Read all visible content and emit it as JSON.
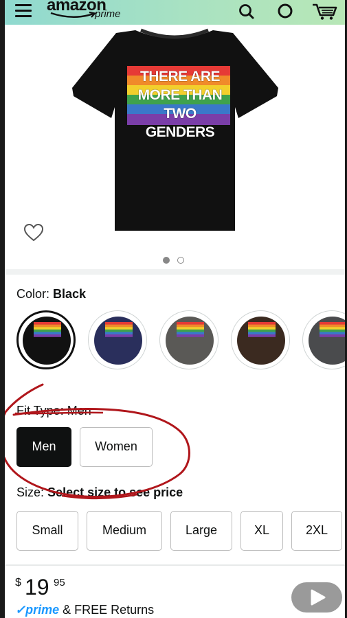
{
  "header": {
    "logo_main": "amazon",
    "logo_sub": "prime",
    "menu_icon": "hamburger-menu-icon",
    "search_icon": "search-icon",
    "voice_icon": "circle-icon",
    "cart_icon": "cart-icon"
  },
  "product": {
    "shirt_text_lines": [
      "THERE ARE",
      "MORE THAN",
      "TWO GENDERS"
    ],
    "shirt_color": "#111111",
    "image_dots": {
      "count": 2,
      "active": 1
    }
  },
  "color_selector": {
    "label": "Color:",
    "value": "Black",
    "swatches": [
      {
        "name": "Black",
        "hex": "#111111",
        "selected": true
      },
      {
        "name": "Navy",
        "hex": "#2a2f5c",
        "selected": false
      },
      {
        "name": "Gray",
        "hex": "#5a5956",
        "selected": false
      },
      {
        "name": "Brown",
        "hex": "#3b2a20",
        "selected": false
      },
      {
        "name": "Dark Heather",
        "hex": "#4a4b4d",
        "selected": false
      }
    ]
  },
  "fit_type": {
    "label": "Fit Type: Men",
    "options": [
      "Men",
      "Women"
    ],
    "selected": "Men"
  },
  "size": {
    "label": "Size:",
    "hint": "Select size to see price",
    "options": [
      "Small",
      "Medium",
      "Large",
      "XL",
      "2XL"
    ]
  },
  "price": {
    "currency": "$",
    "whole": "19",
    "fraction": "95"
  },
  "shipping": {
    "prime_check": "✓",
    "prime_label": "prime",
    "text": "& FREE Returns"
  },
  "colors": {
    "header_start": "#8fd9d0",
    "header_end": "#b8e7b6",
    "annotation": "#b0161b",
    "prime_blue": "#1a98ff"
  }
}
